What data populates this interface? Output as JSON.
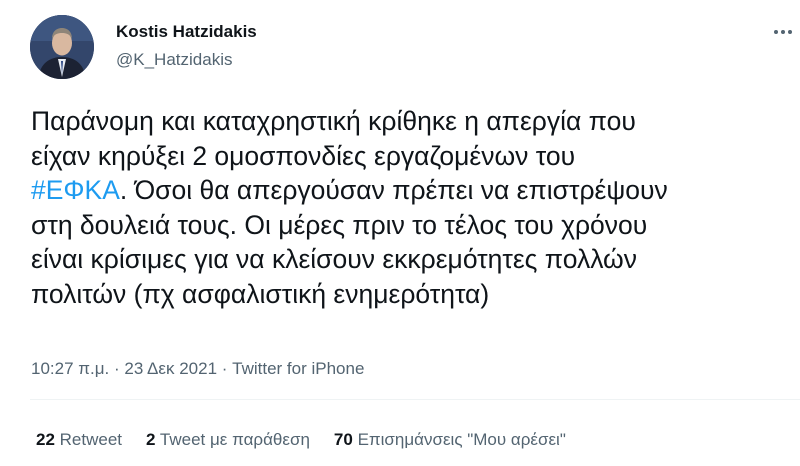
{
  "author": {
    "name": "Kostis Hatzidakis",
    "handle": "@K_Hatzidakis"
  },
  "tweet": {
    "line1": "Παράνομη και καταχρηστική κρίθηκε η απεργία που",
    "line2": "είχαν κηρύξει 2 ομοσπονδίες εργαζομένων του",
    "hashtag": "#ΕΦΚΑ",
    "line3_rest": ". Όσοι θα απεργούσαν πρέπει να επιστρέψουν",
    "line4": "στη δουλειά τους. Οι μέρες πριν το τέλος του χρόνου",
    "line5": "είναι κρίσιμες για να κλείσουν εκκρεμότητες πολλών",
    "line6": "πολιτών (πχ ασφαλιστική ενημερότητα)"
  },
  "meta": {
    "time": "10:27 π.μ.",
    "separator": " · ",
    "date": "23 Δεκ 2021",
    "source": "Twitter for iPhone"
  },
  "stats": {
    "retweets_count": "22",
    "retweets_label": "Retweet",
    "quotes_count": "2",
    "quotes_label": "Tweet με παράθεση",
    "likes_count": "70",
    "likes_label": "Επισημάνσεις \"Μου αρέσει\""
  },
  "colors": {
    "link": "#1d9bf0",
    "secondary_text": "#536471",
    "primary_text": "#0f1419"
  },
  "icons": {
    "more": "more-horizontal-icon"
  }
}
